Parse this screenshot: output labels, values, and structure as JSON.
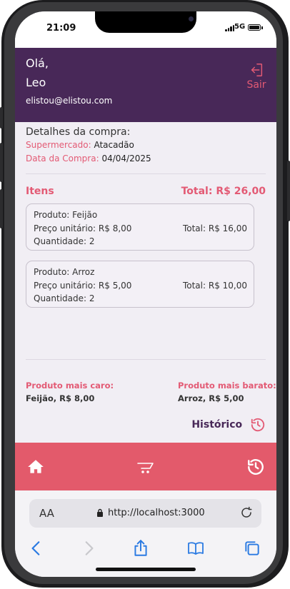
{
  "status_bar": {
    "time": "21:09",
    "network": "5G"
  },
  "header": {
    "greeting": "Olá,",
    "user_name": "Leo",
    "email": "elistou@elistou.com",
    "logout_label": "Sair"
  },
  "purchase": {
    "title": "Detalhes da compra:",
    "store_label": "Supermercado:",
    "store_value": "Atacadão",
    "date_label": "Data da Compra:",
    "date_value": "04/04/2025"
  },
  "items_section": {
    "title": "Itens",
    "total": "Total: R$ 26,00",
    "items": [
      {
        "product": "Produto: Feijão",
        "unit_price": "Preço unitário: R$ 8,00",
        "quantity": "Quantidade: 2",
        "total": "Total: R$ 16,00"
      },
      {
        "product": "Produto: Arroz",
        "unit_price": "Preço unitário: R$ 5,00",
        "quantity": "Quantidade: 2",
        "total": "Total: R$ 10,00"
      }
    ]
  },
  "stats": {
    "most_expensive_label": "Produto mais caro:",
    "most_expensive_value": "Feijão, R$ 8,00",
    "cheapest_label": "Produto mais barato:",
    "cheapest_value": "Arroz, R$ 5,00"
  },
  "history_link": {
    "label": "Histórico"
  },
  "bottom_nav": {
    "icons": [
      "home-icon",
      "cart-icon",
      "history-icon"
    ]
  },
  "browser": {
    "text_size_label": "AA",
    "url": "http://localhost:3000",
    "toolbar_icons": [
      "back-icon",
      "forward-icon",
      "share-icon",
      "bookmarks-icon",
      "tabs-icon"
    ]
  },
  "colors": {
    "header_bg": "#482858",
    "accent": "#e35a74",
    "nav_bg": "#e35a6b",
    "page_bg": "#f1eef4"
  }
}
